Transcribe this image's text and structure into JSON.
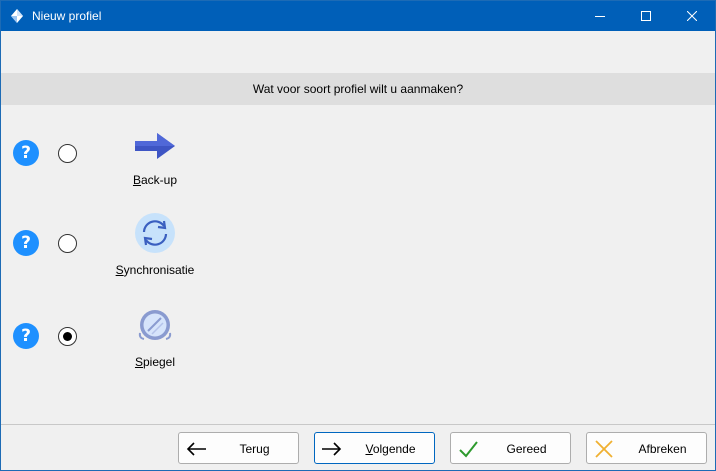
{
  "window": {
    "title": "Nieuw profiel",
    "accent_color": "#005fb8"
  },
  "question": "Wat voor soort profiel wilt u aanmaken?",
  "options": [
    {
      "label_first": "B",
      "label_rest": "ack-up",
      "selected": false,
      "icon": "arrow-right-icon"
    },
    {
      "label_first": "S",
      "label_rest": "ynchronisatie",
      "selected": false,
      "icon": "sync-icon"
    },
    {
      "label_first": "S",
      "label_rest": "piegel",
      "selected": true,
      "icon": "mirror-icon"
    }
  ],
  "buttons": {
    "back": "Terug",
    "next_first": "V",
    "next_rest": "olgende",
    "done": "Gereed",
    "cancel": "Afbreken"
  },
  "help_glyph": "?"
}
